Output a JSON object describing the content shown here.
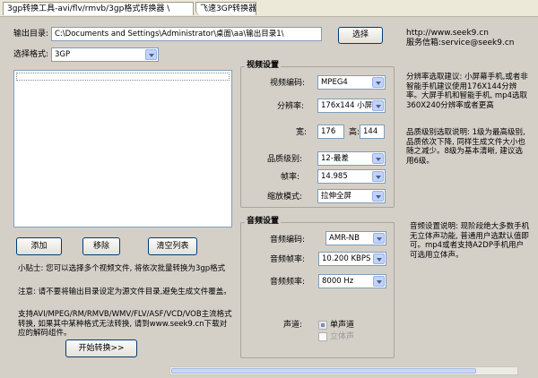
{
  "window": {
    "tabs": [
      {
        "label": "3gp转换工具-avi/flv/rmvb/3gp格式转换器 \\"
      },
      {
        "label": "飞速3GP转换器)"
      }
    ]
  },
  "output": {
    "label": "输出目录:",
    "path": "C:\\Documents and Settings\\Administrator\\桌面\\aa\\输出目录1\\",
    "choose_button": "选择"
  },
  "header_info": {
    "url": "http://www.seek9.cn",
    "email": "服务信箱:service@seek9.cn"
  },
  "format": {
    "label": "选择格式:",
    "value": "3GP"
  },
  "file_buttons": {
    "add": "添加",
    "remove": "移除",
    "clear": "清空列表"
  },
  "tips": {
    "tip1": "小贴士: 您可以选择多个视频文件, 将依次批量转换为3gp格式",
    "tip2": "注意: 请不要将输出目录设定为源文件目录,避免生成文件覆盖。",
    "tip3": "支持AVI/MPEG/RM/RMVB/WMV/FLV/ASF/VCD/VOB主流格式转换, 如果其中某种格式无法转换, 请到www.seek9.cn下载对应的解码组件。"
  },
  "start_button": "开始转换>>",
  "video": {
    "title": "视频设置",
    "codec_label": "视频编码:",
    "codec": "MPEG4",
    "resolution_label": "分辨率:",
    "resolution": "176x144 小屏",
    "width_label": "宽:",
    "width": "176",
    "height_label": "高:",
    "height": "144",
    "quality_label": "品质级别:",
    "quality": "12-最差",
    "fps_label": "帧率:",
    "fps": "14.985",
    "scale_label": "缩放模式:",
    "scale": "拉伸全屏"
  },
  "audio": {
    "title": "音频设置",
    "codec_label": "音频编码:",
    "codec": "AMR-NB",
    "rate_label": "音频帧率:",
    "rate": "10.200 KBPS",
    "freq_label": "音频频率:",
    "freq": "8000 Hz",
    "channel_label": "声道:",
    "mono": "单声道",
    "stereo": "立体声"
  },
  "help": {
    "resolution": "分辨率选取建议: 小屏幕手机,或者非智能手机建议使用176X144分辨率。大屏手机和智能手机, mp4选取360X240分辨率或者更高",
    "quality": "品质级别选取说明: 1级为最高级别, 品质依次下降, 同样生成文件大小也随之减少。8级为基本清晰, 建议选用6级。",
    "audio": "音频设置说明: 现阶段绝大多数手机无立体声功能, 普通用户选默认值即可。mp4或者支持A2DP手机用户可选用立体声。"
  }
}
